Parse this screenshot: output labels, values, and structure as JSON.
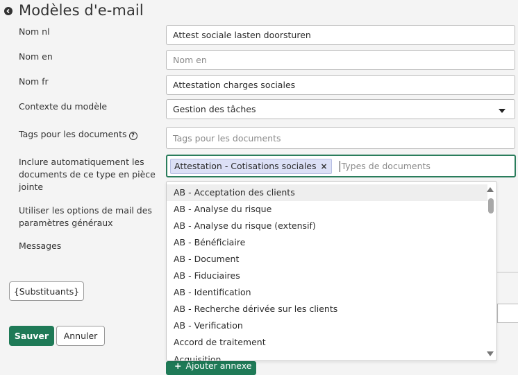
{
  "header": {
    "title": "Modèles d'e-mail"
  },
  "form": {
    "nom_nl": {
      "label": "Nom nl",
      "value": "Attest sociale lasten doorsturen"
    },
    "nom_en": {
      "label": "Nom en",
      "placeholder": "Nom en"
    },
    "nom_fr": {
      "label": "Nom fr",
      "value": "Attestation charges sociales"
    },
    "contexte": {
      "label": "Contexte du modèle",
      "value": "Gestion des tâches"
    },
    "tags_docs": {
      "label": "Tags pour les documents",
      "placeholder": "Tags pour les documents"
    },
    "inclure": {
      "label_line1": "Inclure automatiquement les",
      "label_line2": "documents de ce type en pièce",
      "label_line3": "jointe",
      "chip": "Attestation - Cotisations sociales",
      "chip_remove": "×",
      "placeholder": "Types de documents"
    },
    "utiliser": {
      "label_line1": "Utiliser les options de mail des",
      "label_line2": "paramètres généraux"
    },
    "messages": {
      "label": "Messages"
    }
  },
  "dropdown": {
    "options": [
      "AB - Acceptation des clients",
      "AB - Analyse du risque",
      "AB - Analyse du risque (extensif)",
      "AB - Bénéficiaire",
      "AB - Document",
      "AB - Fiduciaires",
      "AB - Identification",
      "AB - Recherche dérivée sur les clients",
      "AB - Verification",
      "Accord de traitement"
    ],
    "partial_option": "Acquisition"
  },
  "buttons": {
    "substituants": "{Substituants}",
    "save": "Sauver",
    "cancel": "Annuler",
    "add_attachment": "Ajouter annexe",
    "add_attachment_icon": "+"
  },
  "colors": {
    "primary": "#1f7a57",
    "chip_bg": "#dce0f6",
    "focus_border": "#2a7d5c"
  }
}
